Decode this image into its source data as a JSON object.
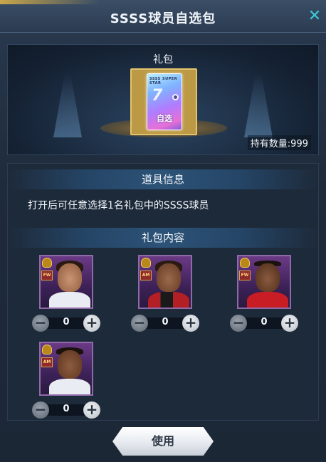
{
  "dialog": {
    "title": "SSSS球员自选包",
    "close_icon": "close-icon"
  },
  "showcase": {
    "pack_label": "礼包",
    "pack_card": {
      "brand": "SSSS SUPER STAR",
      "tag": "自选"
    },
    "quantity_text": "持有数量:999"
  },
  "item_info": {
    "header": "道具信息",
    "description": "打开后可任意选择1名礼包中的SSSS球员"
  },
  "pack_contents": {
    "header": "礼包内容",
    "players": [
      {
        "position": "FW",
        "count": "0"
      },
      {
        "position": "AM",
        "count": "0"
      },
      {
        "position": "FW",
        "count": "0"
      },
      {
        "position": "AM",
        "count": "0"
      }
    ],
    "minus_symbol": "−",
    "plus_symbol": "+"
  },
  "footer": {
    "use_label": "使用"
  },
  "colors": {
    "accent_close": "#3ccbd8",
    "card_purple": "#6b3a86",
    "gold_frame": "#bc9a45"
  }
}
